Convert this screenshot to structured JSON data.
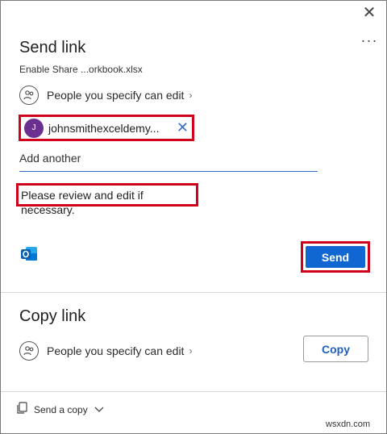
{
  "header": {
    "title": "Send link",
    "file_name": "Enable Share ...orkbook.xlsx",
    "permission": "People you specify can edit",
    "more_glyph": "···",
    "close_glyph": "✕"
  },
  "recipient": {
    "avatar_initial": "J",
    "email": "johnsmithexceldemy...",
    "remove_glyph": "✕"
  },
  "add_another": {
    "placeholder": "Add another"
  },
  "message": {
    "value": "Please review and edit if necessary."
  },
  "send_button": {
    "label": "Send"
  },
  "copy_section": {
    "title": "Copy link",
    "permission": "People you specify can edit",
    "copy_label": "Copy"
  },
  "footer": {
    "send_copy_label": "Send a copy"
  },
  "watermark": "wsxdn.com",
  "colors": {
    "accent": "#1167d1",
    "highlight": "#d0021b",
    "avatar": "#6b2f8f"
  }
}
